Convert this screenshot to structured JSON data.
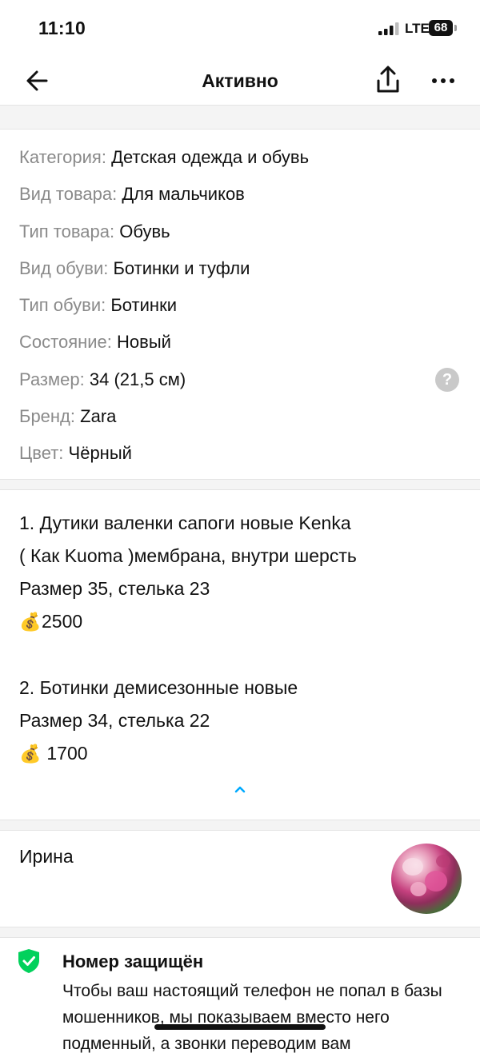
{
  "status_bar": {
    "time": "11:10",
    "network": "LTE",
    "battery": "68"
  },
  "nav": {
    "title": "Активно"
  },
  "params": [
    {
      "label": "Категория:",
      "value": "Детская одежда и обувь"
    },
    {
      "label": "Вид товара:",
      "value": "Для мальчиков"
    },
    {
      "label": "Тип товара:",
      "value": "Обувь"
    },
    {
      "label": "Вид обуви:",
      "value": "Ботинки и туфли"
    },
    {
      "label": "Тип обуви:",
      "value": "Ботинки"
    },
    {
      "label": "Состояние:",
      "value": "Новый"
    },
    {
      "label": "Размер:",
      "value": "34 (21,5 см)"
    },
    {
      "label": "Бренд:",
      "value": "Zara"
    },
    {
      "label": "Цвет:",
      "value": "Чёрный"
    }
  ],
  "help_symbol": "?",
  "description": {
    "item1": {
      "line1": "1. Дутики валенки сапоги новые Kenka",
      "line2": "( Как Kuoma )мембрана, внутри шерсть",
      "line3": "Размер 35, стелька 23",
      "price_icon": "💰",
      "price": "2500"
    },
    "item2": {
      "line1": "2. Ботинки демисезонные новые",
      "line2": "Размер 34, стелька 22",
      "price_icon": "💰",
      "price": " 1700"
    }
  },
  "seller": {
    "name": "Ирина"
  },
  "protection": {
    "title": "Номер защищён",
    "line1": "Чтобы ваш настоящий телефон не попал в базы",
    "line2": "мошенников, мы показываем вместо него",
    "line3": "подменный, а звонки переводим вам"
  },
  "colors": {
    "accent": "#00aaff",
    "shield": "#02d15c",
    "label": "#8a8a8a"
  }
}
